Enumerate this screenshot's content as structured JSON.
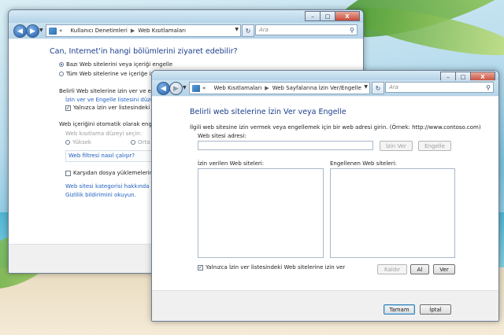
{
  "back_window": {
    "nav": {
      "breadcrumb": [
        "«",
        "Kullanıcı Denetimleri",
        "Web Kısıtlamaları"
      ],
      "search_placeholder": "Ara"
    },
    "heading": "Can, Internet'in hangi bölümlerini ziyaret edebilir?",
    "radio_some": "Bazı Web sitelerini veya içeriği engelle",
    "radio_all": "Tüm Web sitelerine ve içeriğe izin ver",
    "allow_block_heading": "Belirli Web sitelerine izin ver ve engelle",
    "edit_list_link": "İzin ver ve Engelle listesini düzenle",
    "only_allow_checkbox": "Yalnızca İzin ver listesindeki Web s",
    "auto_block_heading": "Web içeriğini otomatik olarak engelle",
    "restriction_level_label": "Web kısıtlama düzeyi seçin:",
    "level_high": "Yüksek",
    "level_medium": "Orta",
    "filter_link": "Web filtresi nasıl çalışır?",
    "block_downloads": "Karşıdan dosya yüklemelerini enge",
    "category_link": "Web sitesi kategorisi hakkında görüş",
    "privacy_link": "Gizlilik bildirimini okuyun."
  },
  "front_window": {
    "nav": {
      "breadcrumb": [
        "«",
        "Web Kısıtlamaları",
        "Web Sayfalarına İzin Ver/Engelle"
      ],
      "search_placeholder": "Ara"
    },
    "heading": "Belirli web sitelerine İzin Ver veya Engelle",
    "instruction": "İlgili web sitesine izin vermek veya engellemek için bir web adresi girin.  (Örnek: http://www.contoso.com)",
    "address_label": "Web sitesi adresi:",
    "address_value": "",
    "allow_button": "İzin Ver",
    "block_button": "Engelle",
    "allowed_list_label": "İzin verilen Web siteleri:",
    "blocked_list_label": "Engellenen Web siteleri:",
    "allowed_sites": [],
    "blocked_sites": [],
    "only_allow_checkbox": "Yalnızca İzin ver listesindeki Web sitelerine izin ver",
    "only_allow_checked": true,
    "remove_button": "Kaldır",
    "import_button": "Al",
    "export_button": "Ver",
    "ok_button": "Tamam",
    "cancel_button": "İptal"
  },
  "caption": {
    "minimize": "–",
    "maximize": "□",
    "close": "X"
  }
}
